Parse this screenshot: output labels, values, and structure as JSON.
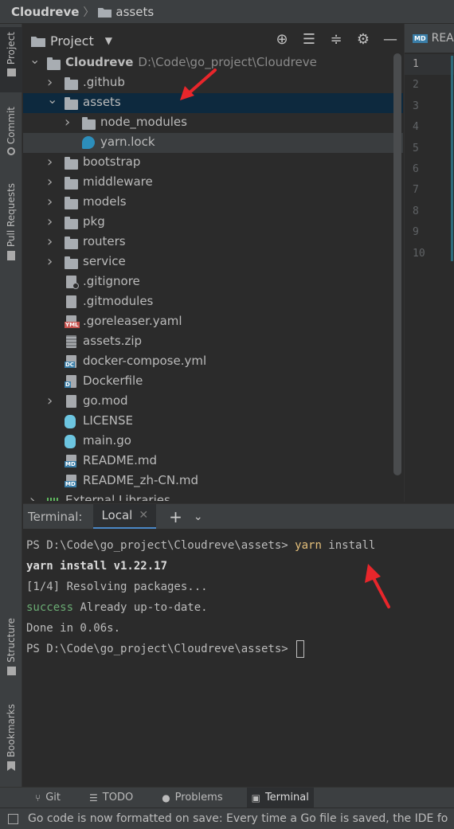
{
  "breadcrumb": {
    "app": "Cloudreve",
    "folder": "assets"
  },
  "left_tabs": [
    "Project",
    "Commit",
    "Pull Requests",
    "Structure",
    "Bookmarks"
  ],
  "project_panel": {
    "title": "Project"
  },
  "tree": [
    {
      "name": "Cloudreve",
      "path": "D:\\Code\\go_project\\Cloudreve",
      "type": "folder",
      "level": 0,
      "expanded": true
    },
    {
      "name": ".github",
      "type": "folder",
      "level": 1,
      "expanded": false
    },
    {
      "name": "assets",
      "type": "folder",
      "level": 1,
      "expanded": true,
      "selected": true
    },
    {
      "name": "node_modules",
      "type": "folder",
      "level": 2,
      "expanded": false
    },
    {
      "name": "yarn.lock",
      "type": "yarn",
      "level": 2,
      "lead": true
    },
    {
      "name": "bootstrap",
      "type": "folder",
      "level": 1
    },
    {
      "name": "middleware",
      "type": "folder",
      "level": 1
    },
    {
      "name": "models",
      "type": "folder",
      "level": 1
    },
    {
      "name": "pkg",
      "type": "folder",
      "level": 1
    },
    {
      "name": "routers",
      "type": "folder",
      "level": 1
    },
    {
      "name": "service",
      "type": "folder",
      "level": 1
    },
    {
      "name": ".gitignore",
      "type": "gitignore",
      "level": 1
    },
    {
      "name": ".gitmodules",
      "type": "file",
      "level": 1
    },
    {
      "name": ".goreleaser.yaml",
      "type": "yml",
      "level": 1
    },
    {
      "name": "assets.zip",
      "type": "zip",
      "level": 1
    },
    {
      "name": "docker-compose.yml",
      "type": "dc",
      "level": 1
    },
    {
      "name": "Dockerfile",
      "type": "docker",
      "level": 1
    },
    {
      "name": "go.mod",
      "type": "gomod",
      "level": 1,
      "hasArrow": true
    },
    {
      "name": "LICENSE",
      "type": "gopher",
      "level": 1
    },
    {
      "name": "main.go",
      "type": "gopher",
      "level": 1
    },
    {
      "name": "README.md",
      "type": "md",
      "level": 1
    },
    {
      "name": "README_zh-CN.md",
      "type": "md",
      "level": 1
    },
    {
      "name": "External Libraries",
      "type": "lib",
      "level": 0
    }
  ],
  "editor": {
    "tab_label": "REA",
    "tab_icon": "MD",
    "line_numbers": [
      "1",
      "2",
      "3",
      "4",
      "5",
      "6",
      "7",
      "8",
      "9",
      "10"
    ]
  },
  "terminal": {
    "label": "Terminal:",
    "tab": "Local",
    "lines": {
      "l1_prompt": "PS D:\\Code\\go_project\\Cloudreve\\assets> ",
      "l1_cmd": "yarn",
      "l1_arg": " install",
      "l2": "yarn install v1.22.17",
      "l3": "[1/4] Resolving packages...",
      "l4_success": "success",
      "l4_rest": " Already up-to-date.",
      "l5": "Done in 0.06s.",
      "l6_prompt": "PS D:\\Code\\go_project\\Cloudreve\\assets> "
    }
  },
  "bottom_tabs": {
    "git": "Git",
    "todo": "TODO",
    "problems": "Problems",
    "terminal": "Terminal"
  },
  "status": {
    "message": "Go code is now formatted on save: Every time a Go file is saved, the IDE fo"
  },
  "colors": {
    "selection": "#0d293e",
    "accent": "#4a88c7",
    "annotation_arrow": "#e8262b",
    "command": "#e5c07b",
    "success": "#6aab73"
  }
}
